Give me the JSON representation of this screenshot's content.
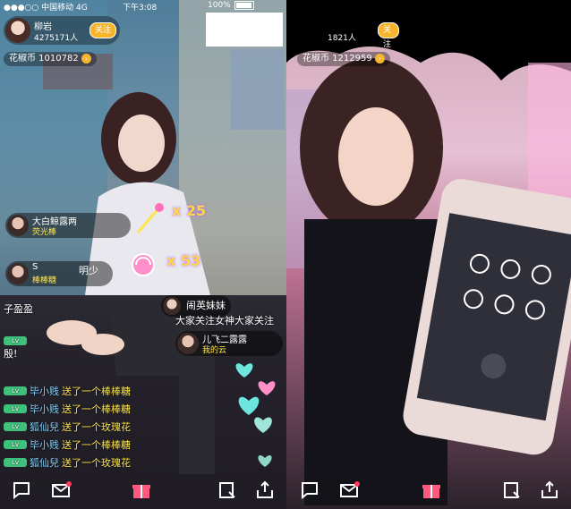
{
  "status_bar": {
    "carrier": "●●●○○ 中国移动 4G",
    "time": "下午3:08",
    "battery": "100%"
  },
  "left_stream": {
    "host_name": "柳岩",
    "viewer_count": "4275171人",
    "follow_label": "关注",
    "coins_label": "花椒币 1010782",
    "gift_banners": [
      {
        "line1": "大白鲸露两",
        "line2": "荧光棒"
      },
      {
        "line1": "S",
        "line2": "棒棒糖"
      },
      {
        "line1": "儿飞二露露",
        "line2": "我的云"
      }
    ],
    "combo_1": "x 25",
    "combo_2": "x 53",
    "side_label_1": "明少",
    "notice": "大家关注女神大家关注",
    "notice_top": "闹英妹妹",
    "chat": [
      {
        "level": "Lv",
        "name": "子盈盈",
        "text": ""
      },
      {
        "level": "Lv",
        "name": "",
        "text": "殷!"
      },
      {
        "level": "Lv",
        "name": "毕小贱",
        "text": "送了一个棒棒糖"
      },
      {
        "level": "Lv",
        "name": "毕小贱",
        "text": "送了一个棒棒糖"
      },
      {
        "level": "Lv",
        "name": "狐仙兒",
        "text": "送了一个玫瑰花"
      },
      {
        "level": "Lv",
        "name": "毕小贱",
        "text": "送了一个棒棒糖"
      },
      {
        "level": "Lv",
        "name": "狐仙兒",
        "text": "送了一个玫瑰花"
      }
    ],
    "toolbar": [
      "chat-icon",
      "mail-icon",
      "gift-icon",
      "record-icon",
      "share-icon"
    ]
  },
  "right_stream": {
    "viewer_count": "1821人",
    "follow_label": "关注",
    "coins_label": "花椒币 1212959",
    "toolbar": [
      "chat-icon",
      "mail-icon",
      "gift-icon",
      "record-icon",
      "share-icon"
    ]
  },
  "colors": {
    "accent": "#f7b52c",
    "level_badge": "#3ec17a",
    "username": "#7fd3ff",
    "gift_text": "#ffe54a"
  }
}
